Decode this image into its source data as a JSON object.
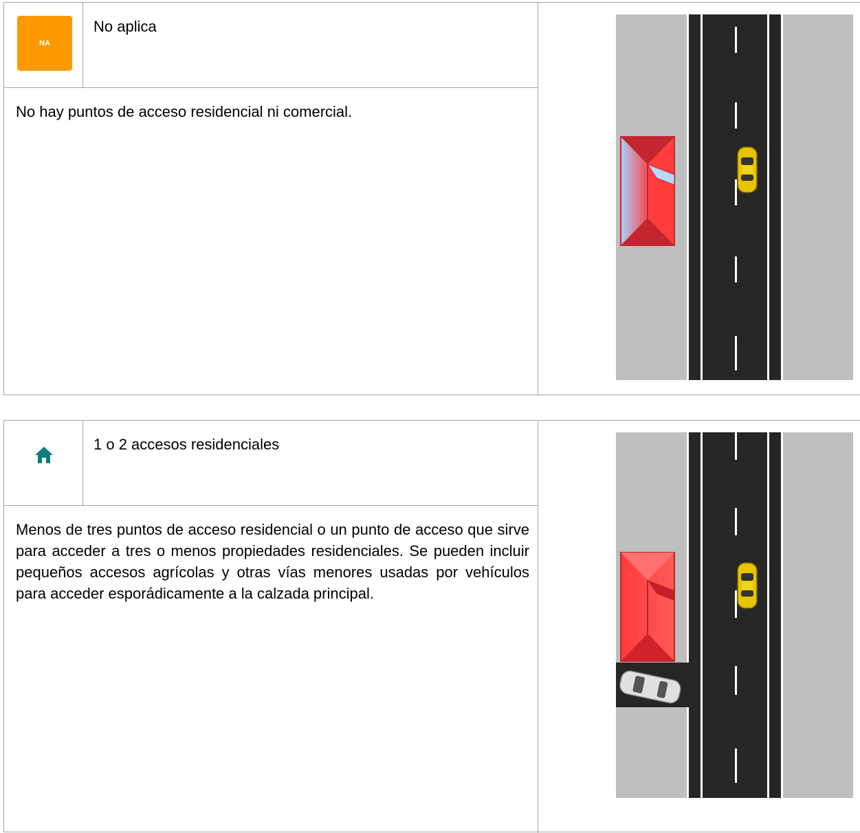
{
  "sections": [
    {
      "badge_text": "NA",
      "icon": "na-badge",
      "title": "No aplica",
      "description": "No hay puntos de acceso residencial ni comercial."
    },
    {
      "icon": "house-icon",
      "title": "1 o 2 accesos residenciales",
      "description": "Menos de tres puntos de acceso residencial o un punto de acceso que sirve para acceder a tres o menos propiedades residenciales. Se pueden incluir pequeños accesos agrícolas y otras vías menores usadas por vehículos para acceder esporádicamente a la calzada principal."
    }
  ],
  "colors": {
    "badge_orange": "#ff9900",
    "icon_teal": "#107c7c",
    "road": "#262626",
    "verge": "#bfbfbf",
    "house_red": "#ff3333",
    "car_yellow": "#e8c400"
  }
}
